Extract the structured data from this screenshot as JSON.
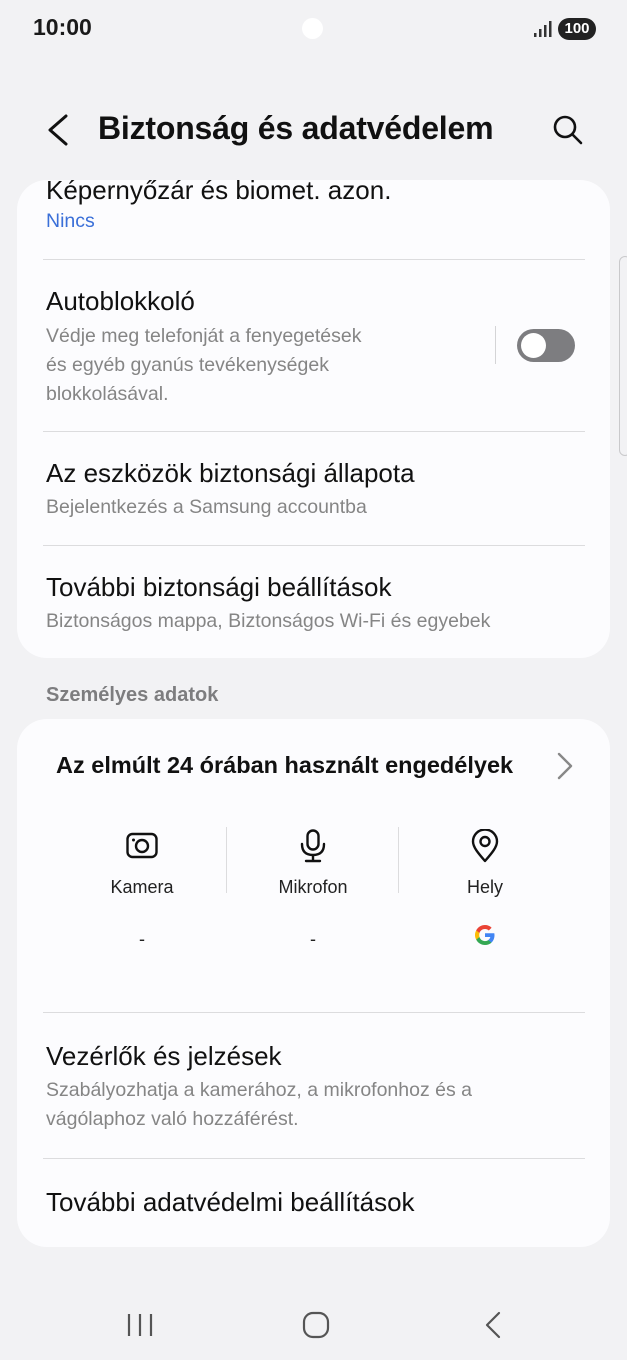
{
  "status_bar": {
    "time": "10:00",
    "battery": "100",
    "icons": [
      "signal-icon",
      "battery-icon"
    ]
  },
  "header": {
    "title": "Biztonság és adatvédelem",
    "back_icon": "back-chevron-icon",
    "search_icon": "search-icon"
  },
  "security_card": {
    "items": [
      {
        "title": "Képernyőzár és biomet. azon.",
        "subtitle": "Nincs"
      },
      {
        "title": "Autoblokkoló",
        "subtitle_lines": [
          "Védje meg telefonját a fenyegetések",
          "és egyéb gyanús tevékenységek",
          "blokkolásával."
        ],
        "toggle_on": false
      },
      {
        "title": "Az eszközök biztonsági állapota",
        "subtitle": "Bejelentkezés a Samsung accountba"
      },
      {
        "title": "További biztonsági beállítások",
        "subtitle": "Biztonságos mappa, Biztonságos Wi-Fi és egyebek"
      }
    ]
  },
  "privacy_section": {
    "label": "Személyes adatok",
    "permissions_card": {
      "title": "Az elmúlt 24 órában használt engedélyek",
      "columns": [
        {
          "icon": "camera-icon",
          "label": "Kamera",
          "usage": "-"
        },
        {
          "icon": "microphone-icon",
          "label": "Mikrofon",
          "usage": "-"
        },
        {
          "icon": "location-pin-icon",
          "label": "Hely",
          "usage_icon": "google-icon"
        }
      ]
    },
    "items": [
      {
        "title": "Vezérlők és jelzések",
        "subtitle_lines": [
          "Szabályozhatja a kamerához, a mikrofonhoz és a",
          "vágólaphoz való hozzáférést."
        ]
      },
      {
        "title": "További adatvédelmi beállítások"
      }
    ]
  },
  "nav_bar": {
    "icons": [
      "recent-apps-icon",
      "home-icon",
      "back-icon"
    ]
  },
  "colors": {
    "background": "#f2f2f4",
    "card": "#fcfcfe",
    "link_blue": "#3a6fd8",
    "subtext": "#858585",
    "toggle_off": "#7d7d80"
  }
}
